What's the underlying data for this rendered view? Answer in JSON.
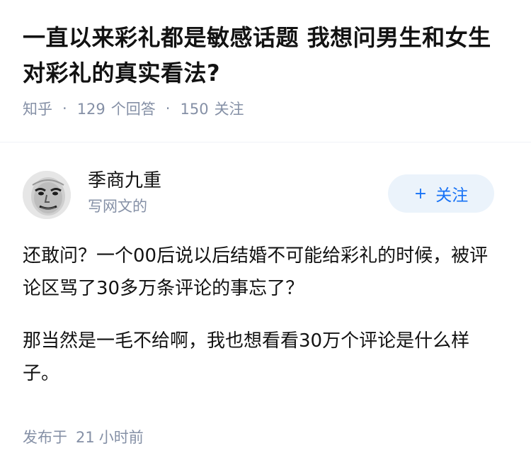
{
  "question": {
    "title": "一直以来彩礼都是敏感话题 我想问男生和女生对彩礼的真实看法?",
    "source": "知乎",
    "separator": "·",
    "answer_count": "129",
    "answer_label": "个回答",
    "follower_count": "150",
    "follower_label": "关注"
  },
  "author": {
    "name": "季商九重",
    "bio": "写网文的",
    "avatar_icon": "meme-face-avatar",
    "follow_label": "关注",
    "follow_icon": "plus-icon",
    "accent_color": "#1772f6",
    "button_bg": "#ebf3fb"
  },
  "answer": {
    "paragraphs": [
      "还敢问？一个00后说以后结婚不可能给彩礼的时候，被评论区骂了30多万条评论的事忘了？",
      "那当然是一毛不给啊，我也想看看30万个评论是什么样子。"
    ]
  },
  "footer": {
    "published_prefix": "发布于",
    "published_num": "21",
    "published_suffix": "小时前"
  }
}
